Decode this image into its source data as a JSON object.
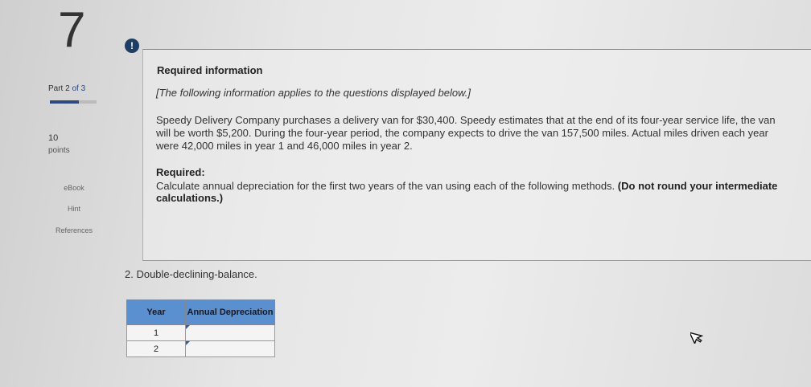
{
  "question": {
    "number": "7"
  },
  "sidebar": {
    "part_prefix": "Part",
    "part_current": "2",
    "part_of": "of 3",
    "points_value": "10",
    "points_label": "points",
    "links": [
      "eBook",
      "Hint",
      "References"
    ]
  },
  "alert": {
    "symbol": "!"
  },
  "info": {
    "title": "Required information",
    "note": "[The following information applies to the questions displayed below.]",
    "paragraph": "Speedy Delivery Company purchases a delivery van for $30,400. Speedy estimates that at the end of its four-year service life, the van will be worth $5,200. During the four-year period, the company expects to drive the van 157,500 miles. Actual miles driven each year were 42,000 miles in year 1 and 46,000 miles in year 2.",
    "required_label": "Required:",
    "required_text": "Calculate annual depreciation for the first two years of the van using each of the following methods.",
    "required_bold": "(Do not round your intermediate calculations.)"
  },
  "sub_question": "2. Double-declining-balance.",
  "table": {
    "headers": [
      "Year",
      "Annual Depreciation"
    ],
    "rows": [
      {
        "year": "1",
        "value": ""
      },
      {
        "year": "2",
        "value": ""
      }
    ]
  }
}
